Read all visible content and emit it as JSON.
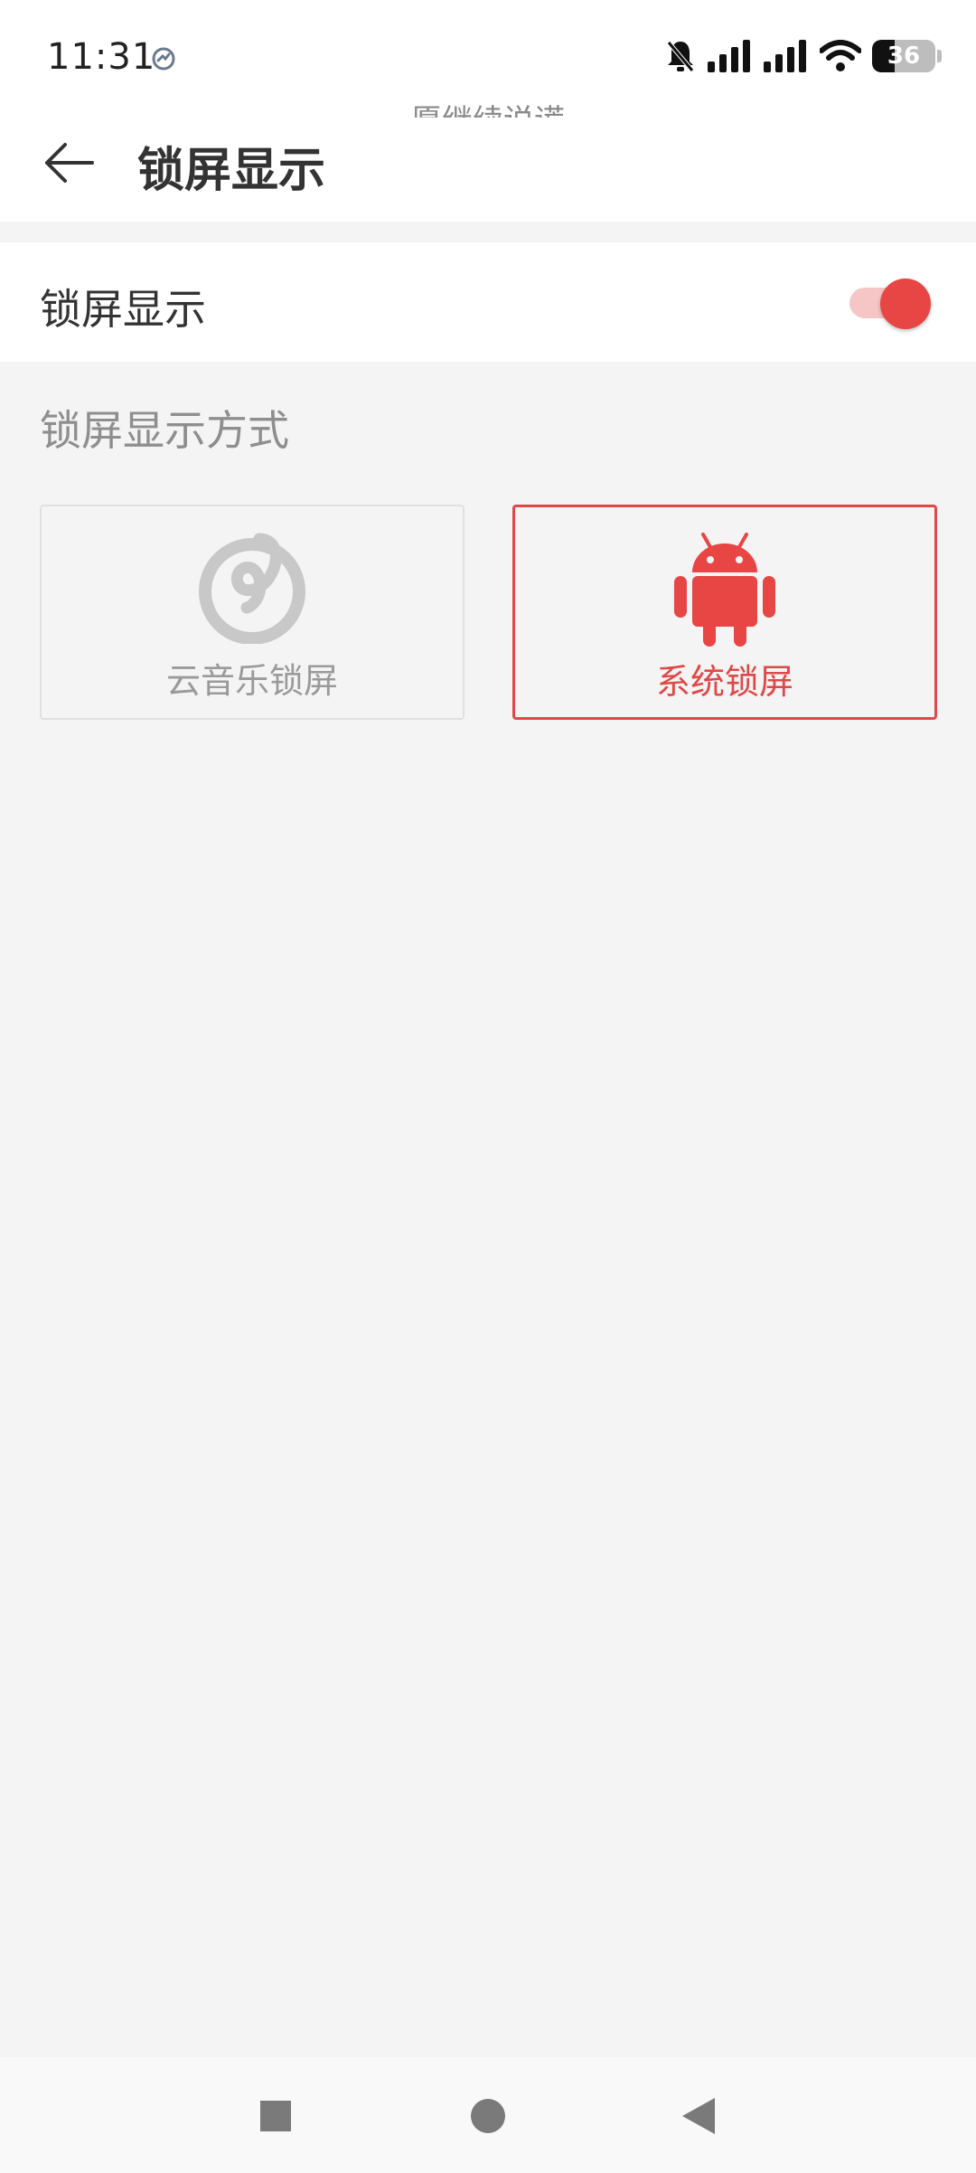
{
  "status_bar": {
    "time": "11:31",
    "battery_level": "36",
    "battery_fraction": 0.36,
    "icons": [
      "sync-icon",
      "bell-muted-icon",
      "signal-icon",
      "signal-icon",
      "wifi-icon",
      "battery-icon"
    ]
  },
  "lyric": "愿继续说谎",
  "header": {
    "title": "锁屏显示",
    "back_icon": "arrow-left-icon"
  },
  "setting": {
    "label": "锁屏显示",
    "toggle_on": true
  },
  "section": {
    "title": "锁屏显示方式"
  },
  "options": [
    {
      "label": "云音乐锁屏",
      "icon": "netease-music-icon",
      "selected": false
    },
    {
      "label": "系统锁屏",
      "icon": "android-icon",
      "selected": true
    }
  ],
  "nav": {
    "recents_icon": "square-icon",
    "home_icon": "circle-icon",
    "back_icon": "triangle-back-icon"
  },
  "colors": {
    "accent": "#e84545",
    "accent_light": "#f6c6c6",
    "background": "#f4f4f4",
    "card_border": "#e0e0e0",
    "muted_text": "#8e8e8e"
  }
}
